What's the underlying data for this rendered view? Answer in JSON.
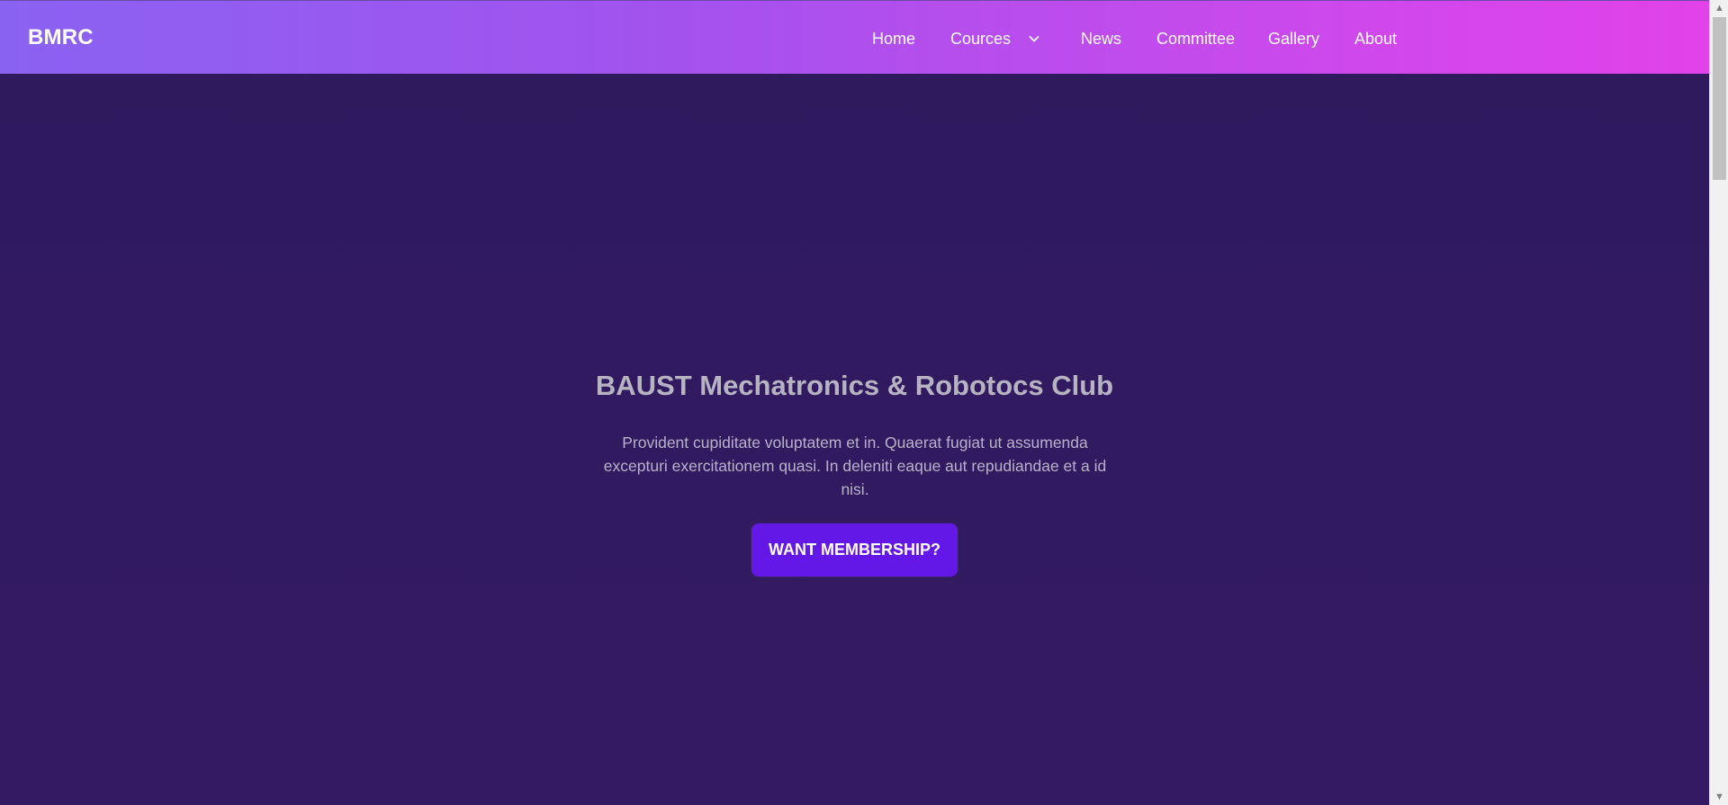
{
  "brand": {
    "name": "BMRC"
  },
  "navbar": {
    "items": [
      {
        "label": "Home"
      },
      {
        "label": "Cources",
        "icon": "chevron-down-icon"
      },
      {
        "label": "News"
      },
      {
        "label": "Committee"
      },
      {
        "label": "Gallery"
      },
      {
        "label": "About"
      }
    ]
  },
  "hero": {
    "title": "BAUST Mechatronics & Robotocs Club",
    "description": "Provident cupiditate voluptatem et in. Quaerat fugiat ut assumenda excepturi exercitationem quasi. In deleniti eaque aut repudiandae et a id nisi.",
    "button_label": "WANT MEMBERSHIP?"
  },
  "colors": {
    "nav_start": "#8a62f2",
    "nav_end": "#e242ea",
    "page_background": "#321a5f",
    "button_background": "#6418e8",
    "title_text": "#b7b3c2"
  },
  "icons": {
    "dropdown": "chevron-down-icon",
    "scroll_up": "scroll-up-arrow-icon",
    "scroll_down": "scroll-down-arrow-icon"
  }
}
